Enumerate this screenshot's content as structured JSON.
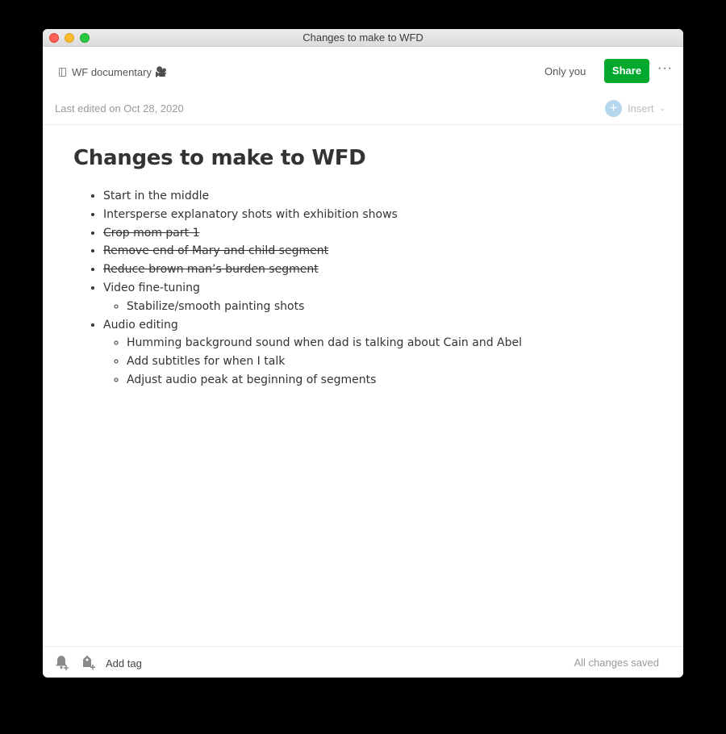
{
  "window": {
    "title": "Changes to make to WFD"
  },
  "header": {
    "notebook_name": "WF documentary",
    "notebook_emoji": "🎥",
    "sharing_status": "Only you",
    "share_label": "Share",
    "more_label": "···",
    "last_edited": "Last edited on Oct 28, 2020",
    "insert_label": "Insert"
  },
  "note": {
    "title": "Changes to make to WFD",
    "items": [
      {
        "text": "Start in the middle",
        "struck": false
      },
      {
        "text": "Intersperse explanatory shots with exhibition shows",
        "struck": false
      },
      {
        "text": "Crop mom part 1",
        "struck": true
      },
      {
        "text": "Remove end of Mary and child segment ",
        "struck": true
      },
      {
        "text": "Reduce brown man’s burden segment",
        "struck": true
      },
      {
        "text": "Video fine-tuning",
        "struck": false,
        "children": [
          "Stabilize/smooth painting shots"
        ]
      },
      {
        "text": "Audio editing",
        "struck": false,
        "children": [
          "Humming background sound when dad is talking about Cain and Abel",
          "Add subtitles for when I talk",
          "Adjust audio peak at beginning of segments"
        ]
      }
    ]
  },
  "footer": {
    "add_tag_label": "Add tag",
    "save_status": "All changes saved"
  },
  "colors": {
    "accent": "#00a82d",
    "insert_plus": "#b5d6ec"
  },
  "icons": {
    "reminder": "bell-plus-icon",
    "tag": "tag-plus-icon",
    "notebook": "notebook-icon",
    "more": "more-dots-icon"
  }
}
